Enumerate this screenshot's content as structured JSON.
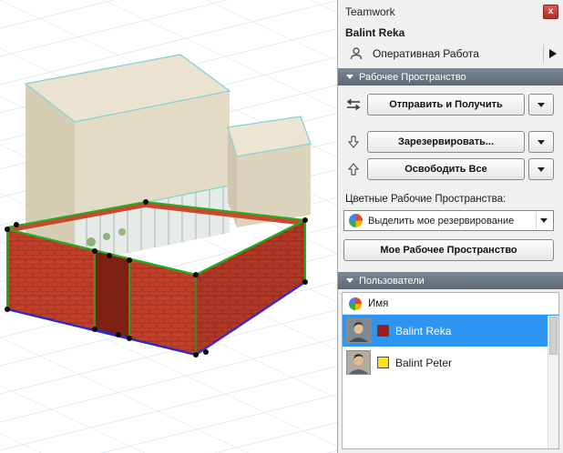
{
  "palette": {
    "title": "Teamwork",
    "close_glyph": "x",
    "current_user": "Balint Reka",
    "work_mode": "Оперативная Работа",
    "sections": {
      "workspace": "Рабочее Пространство",
      "users": "Пользователи"
    },
    "buttons": {
      "send_receive": "Отправить и Получить",
      "reserve": "Зарезервировать...",
      "release_all": "Освободить Все",
      "my_workspace": "Мое Рабочее Пространство"
    },
    "colored_workspaces_label": "Цветные Рабочие Пространства:",
    "highlight_select": {
      "value": "Выделить мое резервирование"
    },
    "users_table": {
      "name_header": "Имя",
      "rows": [
        {
          "name": "Balint Reka",
          "color": "#9e1a20",
          "selected": true
        },
        {
          "name": "Balint Peter",
          "color": "#ffe213",
          "selected": false
        }
      ]
    }
  },
  "colors": {
    "selected_row_bg": "#2e95f2",
    "section_header_bg": "#66727e",
    "close_button_bg": "#c73b31",
    "grid_line": "#c7d9e8",
    "selection_edge_green": "#1faf1f",
    "selection_edge_blue": "#2929cc",
    "top_edge_cyan": "#85d2d0",
    "brick_red": "#c2402a"
  },
  "icons": {
    "close": "close-icon",
    "work_mode": "person-icon",
    "mode_flyout": "arrow-right-icon",
    "send_receive": "swap-arrows-icon",
    "reserve": "arrow-down-icon",
    "release": "arrow-up-icon",
    "colored_workspaces": "color-wheel-icon",
    "dropdowns": "chevron-down-icon"
  }
}
